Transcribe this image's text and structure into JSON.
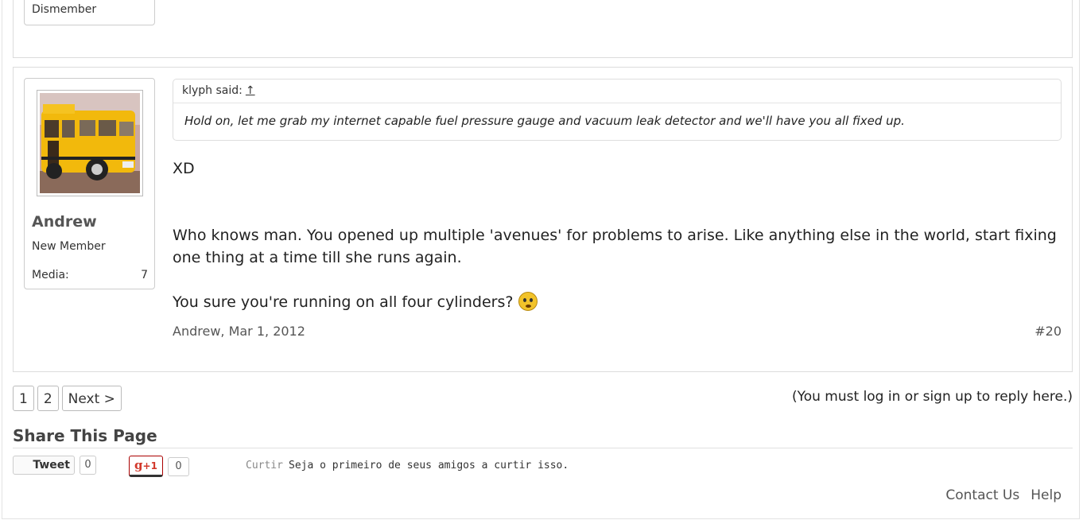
{
  "previous_post": {
    "user_title": "Dismember"
  },
  "post": {
    "author": "Andrew",
    "user_title": "New Member",
    "media_label": "Media:",
    "media_count": "7",
    "quote": {
      "author_said": "klyph said:",
      "jump_arrow": "↑",
      "text": "Hold on, let me grab my internet capable fuel pressure gauge and vacuum leak detector and we'll have you all fixed up."
    },
    "paragraphs": [
      "XD",
      "Who knows man. You opened up multiple 'avenues' for problems to arise. Like anything else in the world, start fixing one thing at a time till she runs again.",
      "You sure you're running on all four cylinders?"
    ],
    "emoji_icon": "confused-smiley-icon",
    "date_line": "Andrew, Mar 1, 2012",
    "post_number": "#20"
  },
  "pager": {
    "pages": [
      "1",
      "2"
    ],
    "next_label": "Next >"
  },
  "reply_note": {
    "prefix": "(You must ",
    "login": "log in",
    "or": " or ",
    "signup": "sign up",
    "suffix": " to reply here.)"
  },
  "share": {
    "title": "Share This Page",
    "tweet_label": "Tweet",
    "tweet_count": "0",
    "gplus_label": "+1",
    "gplus_count": "0",
    "like_label": "Curtir",
    "like_text": "Seja o primeiro de seus amigos a curtir isso."
  },
  "footer": {
    "contact": "Contact Us",
    "help": "Help"
  },
  "colors": {
    "accent": "#d2382b",
    "border": "#dcdcdc",
    "avatar_bus": "#f2b90c"
  }
}
